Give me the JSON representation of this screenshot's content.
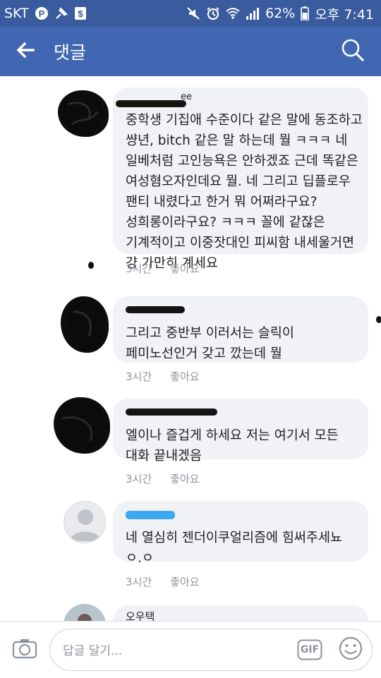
{
  "status_bar": {
    "carrier": "SKT",
    "battery": "62%",
    "time": "오후 7:41",
    "icons": [
      "pinterest-icon",
      "pin-icon",
      "money-icon",
      "mute-icon",
      "alarm-icon",
      "wifi-icon",
      "signal-icon",
      "battery-icon"
    ]
  },
  "header": {
    "title": "댓글",
    "back_icon": "back-arrow-icon",
    "search_icon": "search-icon"
  },
  "comments": [
    {
      "author_visible_fragment": "ee",
      "lines": [
        "중학생 기집애 수준이다 같은 말에 동조하고",
        "썅년, bitch 같은 말 하는데 뭘 ㅋㅋㅋ 네",
        "일베처럼 고인능욕은 안하겠죠 근데 똑같은",
        "여성혐오자인데요 뭘. 네 그리고 딥플로우",
        "팬티 내렸다고 한거 뭐 어쩌라구요?",
        "성희롱이라구요? ㅋㅋㅋ 꼴에 같잖은",
        "기계적이고 이중잣대인 피씨함 내세울거면",
        "걍 가만히 계세요"
      ],
      "time": "3시간",
      "like": "좋아요"
    },
    {
      "lines": [
        "그리고 중반부 이러서는 슬릭이",
        "페미노선인거 갖고 깠는데 뭘"
      ],
      "time": "3시간",
      "like": "좋아요"
    },
    {
      "lines": [
        "엘이나 즐겁게 하세요 저는 여기서 모든",
        "대화 끝내겠음"
      ],
      "time": "3시간",
      "like": "좋아요"
    },
    {
      "lines": [
        "네 열심히 젠더이쿠얼리즘에 힘써주세뇨",
        "ㅇ.ㅇ"
      ],
      "time": "3시간",
      "like": "좋아요"
    },
    {
      "author": "오우택"
    }
  ],
  "footer": {
    "placeholder": "답글 달기...",
    "gif_label": "GIF",
    "camera_icon": "camera-icon",
    "emoji_icon": "emoji-icon"
  },
  "colors": {
    "header_bg": "#4267b2",
    "status_bg": "#3a5b9e",
    "bubble_bg": "#f0f2f5",
    "meta_text": "#90949c"
  }
}
